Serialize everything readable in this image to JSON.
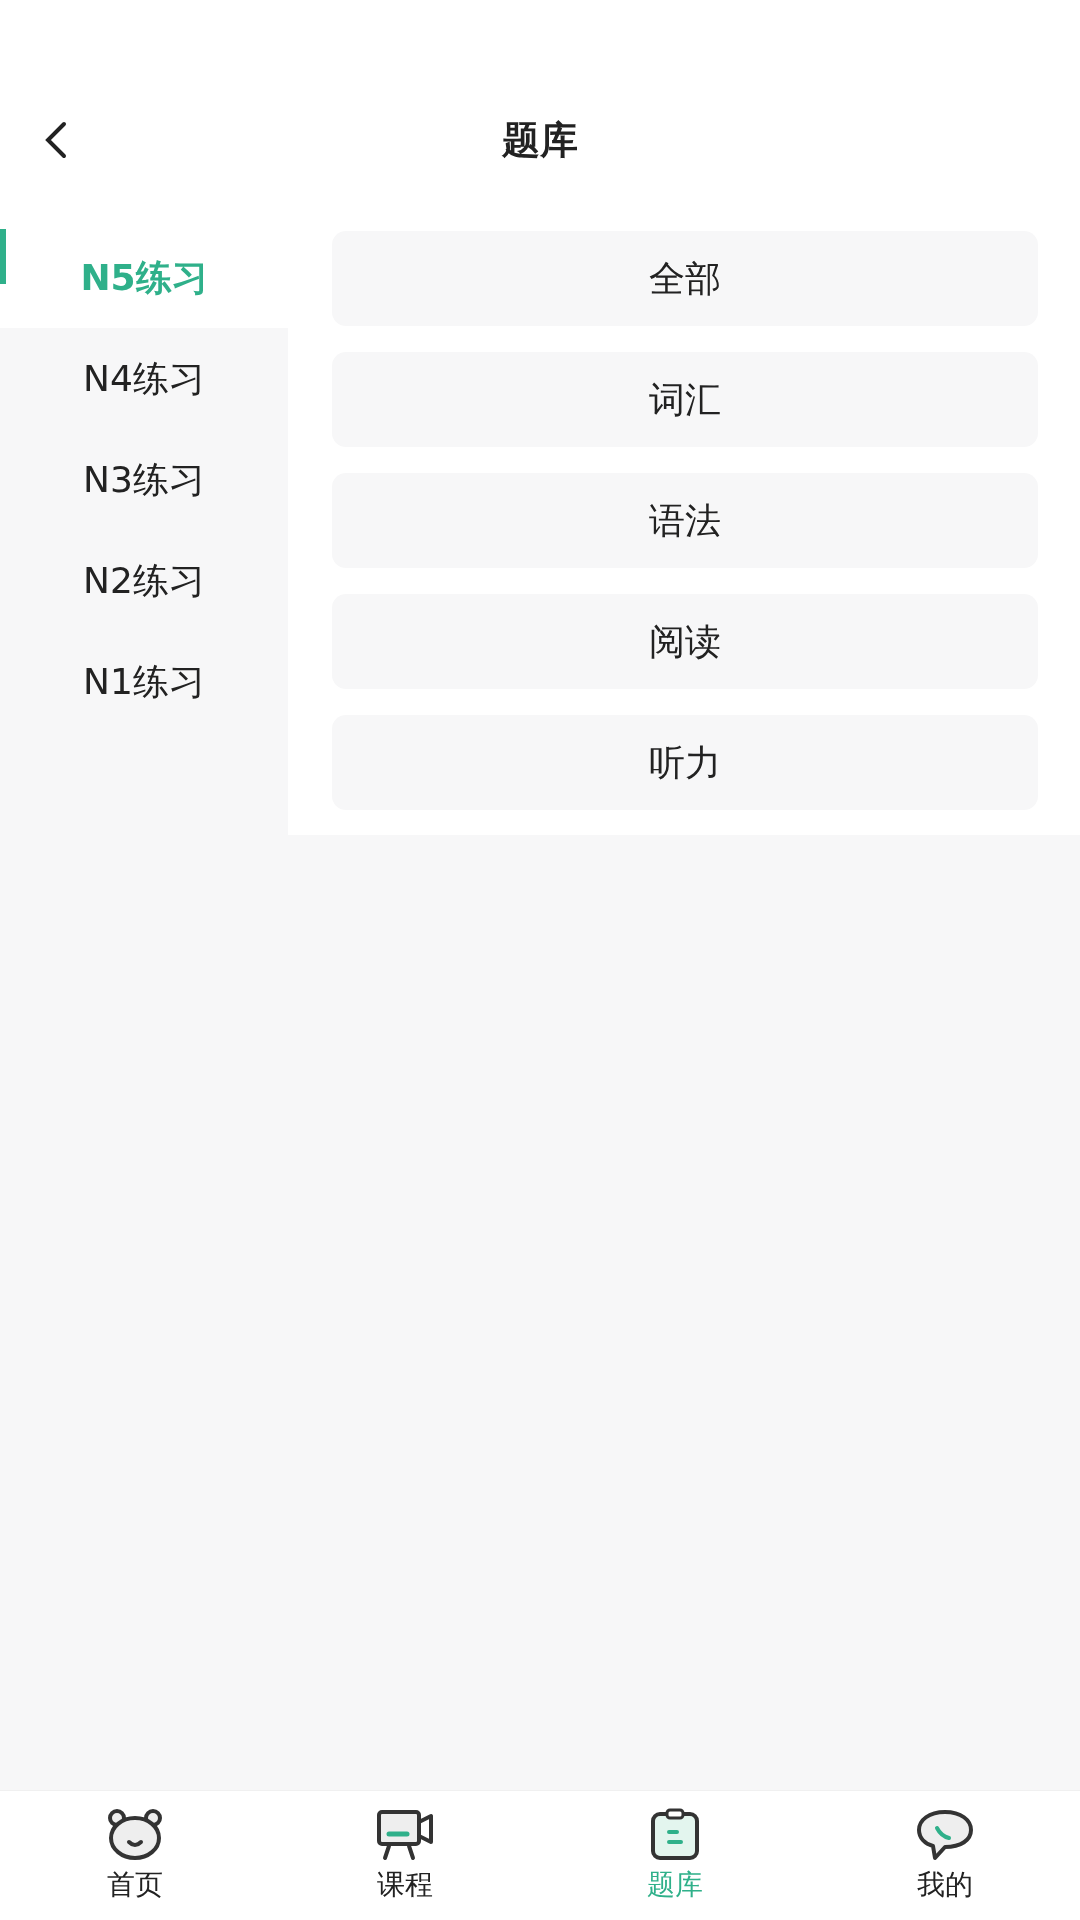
{
  "header": {
    "title": "题库"
  },
  "levels": [
    {
      "label": "N5练习",
      "selected": true
    },
    {
      "label": "N4练习",
      "selected": false
    },
    {
      "label": "N3练习",
      "selected": false
    },
    {
      "label": "N2练习",
      "selected": false
    },
    {
      "label": "N1练习",
      "selected": false
    }
  ],
  "categories": [
    "全部",
    "词汇",
    "语法",
    "阅读",
    "听力"
  ],
  "tab_bar": [
    {
      "label": "首页",
      "kind": "bear",
      "selected": false
    },
    {
      "label": "课程",
      "kind": "video",
      "selected": false
    },
    {
      "label": "题库",
      "kind": "clipboard",
      "selected": true
    },
    {
      "label": "我的",
      "kind": "chat",
      "selected": false
    }
  ]
}
